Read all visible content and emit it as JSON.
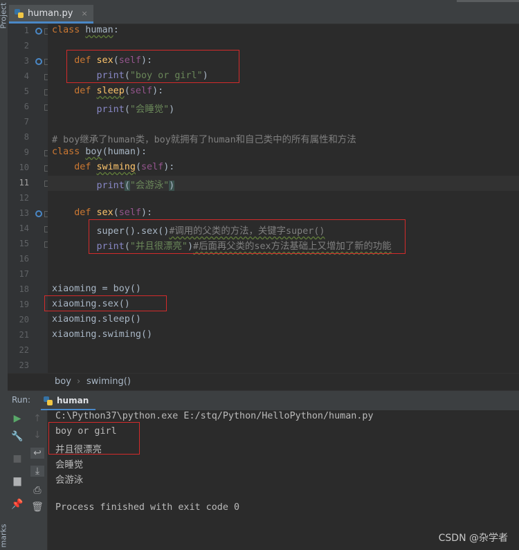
{
  "side_labels": {
    "project": "Project",
    "marks": "marks"
  },
  "tab": {
    "filename": "human.py",
    "close": "×"
  },
  "editor": {
    "line_numbers": [
      "1",
      "2",
      "3",
      "4",
      "5",
      "6",
      "7",
      "8",
      "9",
      "10",
      "11",
      "12",
      "13",
      "14",
      "15",
      "16",
      "17",
      "18",
      "19",
      "20",
      "21",
      "22",
      "23"
    ],
    "current_line": "11",
    "code": {
      "l1": {
        "kw": "class",
        "name": "human",
        "colon": ":"
      },
      "l3": {
        "kw": "def",
        "fn": "sex",
        "open": "(",
        "self": "self",
        "close": "):"
      },
      "l4": {
        "fn": "print",
        "open": "(",
        "str": "\"boy or girl\"",
        "close": ")"
      },
      "l5": {
        "kw": "def",
        "fn": "sleep",
        "open": "(",
        "self": "self",
        "close": "):"
      },
      "l6": {
        "fn": "print",
        "open": "(",
        "str": "\"会睡觉\"",
        "close": ")"
      },
      "l8": {
        "comment": "# boy继承了human类，boy就拥有了human和自己类中的所有属性和方法"
      },
      "l9": {
        "kw": "class",
        "name": "boy",
        "args": "(human):"
      },
      "l10": {
        "kw": "def",
        "fn": "swiming",
        "open": "(",
        "self": "self",
        "close": "):"
      },
      "l11": {
        "fn": "print",
        "open": "(",
        "str": "\"会游泳\"",
        "close": ")"
      },
      "l13": {
        "kw": "def",
        "fn": "sex",
        "open": "(",
        "self": "self",
        "close": "):"
      },
      "l14": {
        "call": "super().sex()",
        "comment": "#调用的父类的方法，关键字super()"
      },
      "l15": {
        "fn": "print",
        "open": "(",
        "str": "\"并且很漂亮\"",
        "close": ")",
        "comment": "#后面再父类的sex方法基础上又增加了新的功能"
      },
      "l18": "xiaoming = boy()",
      "l19": "xiaoming.sex()",
      "l20": "xiaoming.sleep()",
      "l21": "xiaoming.swiming()"
    }
  },
  "breadcrumb": {
    "class": "boy",
    "sep": "›",
    "method": "swiming()"
  },
  "run": {
    "label": "Run:",
    "tab": "human",
    "output": [
      "C:\\Python37\\python.exe E:/stq/Python/HelloPython/human.py",
      "boy or girl",
      "并且很漂亮",
      "会睡觉",
      "会游泳",
      "",
      "Process finished with exit code 0"
    ]
  },
  "watermark": "CSDN @杂学者",
  "colors": {
    "accent": "#4a88c7",
    "annotation_box": "#d42b2b",
    "keyword": "#cc7832",
    "string": "#6a8759"
  }
}
